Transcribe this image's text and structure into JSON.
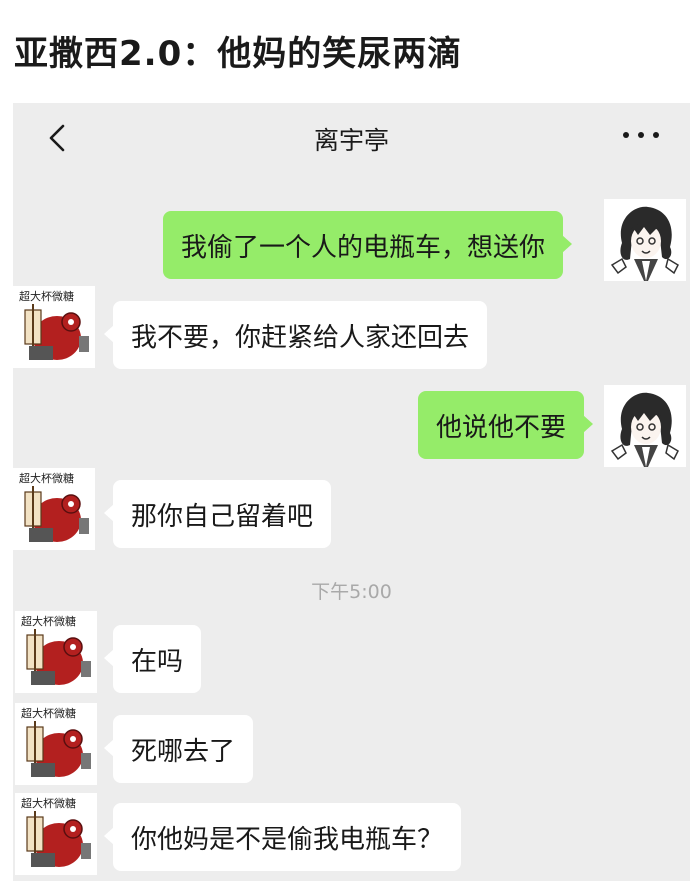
{
  "post": {
    "title": "亚撒西2.0：他妈的笑尿两滴"
  },
  "chat": {
    "contact_name": "离宇亭",
    "back_icon": "chevron-left-icon",
    "more_icon": "ellipsis-icon",
    "timestamp": "下午5:00",
    "colors": {
      "outgoing_bubble": "#95ec69",
      "incoming_bubble": "#ffffff",
      "background": "#ededed"
    },
    "sticker_text": "超大杯微糖",
    "messages": [
      {
        "side": "outgoing",
        "text": "我偷了一个人的电瓶车，想送你"
      },
      {
        "side": "incoming",
        "text": "我不要，你赶紧给人家还回去"
      },
      {
        "side": "outgoing",
        "text": "他说他不要"
      },
      {
        "side": "incoming",
        "text": "那你自己留着吧"
      },
      {
        "side": "incoming",
        "text": "在吗"
      },
      {
        "side": "incoming",
        "text": "死哪去了"
      },
      {
        "side": "incoming",
        "text": "你他妈是不是偷我电瓶车？"
      }
    ]
  }
}
